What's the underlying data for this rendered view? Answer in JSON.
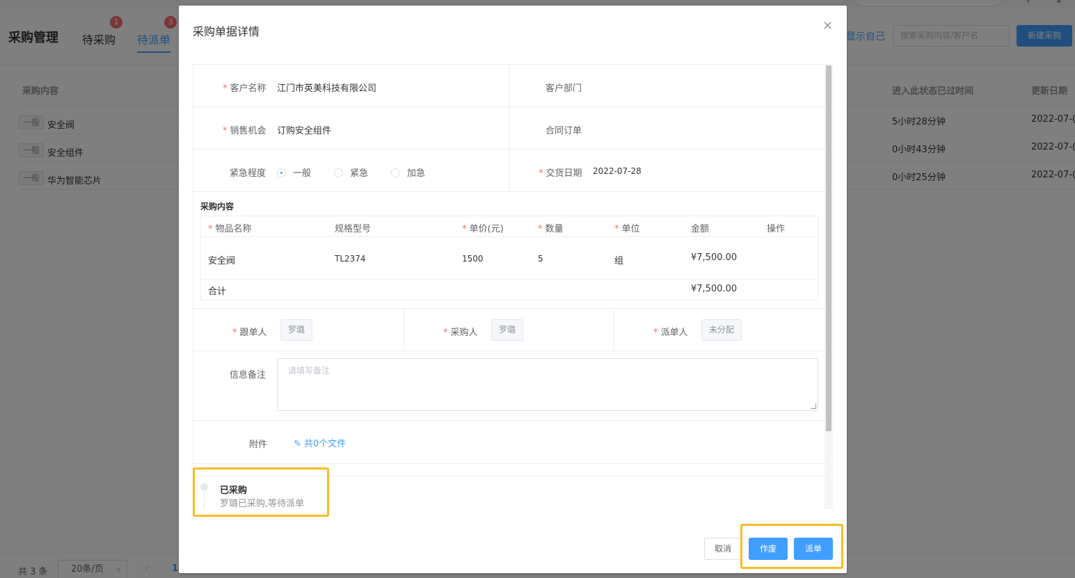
{
  "bg": {
    "title": "采购管理",
    "tabs": [
      {
        "label": "待采购",
        "badge": "1"
      },
      {
        "label": "待派单",
        "badge": "3"
      }
    ],
    "show_self": "显示自己",
    "search_placeholder": "搜索采购内容/客户名",
    "new_button": "新建采购",
    "columns": {
      "content": "采购内容",
      "elapsed": "进入此状态已过时间",
      "update": "更新日期"
    },
    "rows": [
      {
        "tag": "一般",
        "name": "安全阀",
        "elapsed": "5小时28分钟",
        "date": "2022-07-("
      },
      {
        "tag": "一般",
        "name": "安全组件",
        "elapsed": "0小时43分钟",
        "date": "2022-07-("
      },
      {
        "tag": "一般",
        "name": "华为智能芯片",
        "elapsed": "0小时25分钟",
        "date": "2022-07-("
      }
    ],
    "pagination": {
      "total": "共 3 条",
      "page_size": "20条/页",
      "current": "1"
    }
  },
  "dialog": {
    "title": "采购单据详情",
    "close": "×",
    "customer_label": "客户名称",
    "customer_value": "江门市英美科技有限公司",
    "dept_label": "客户部门",
    "opportunity_label": "销售机会",
    "opportunity_value": "订购安全组件",
    "contract_label": "合同订单",
    "urgency_label": "紧急程度",
    "urgency_options": [
      "一般",
      "紧急",
      "加急"
    ],
    "delivery_label": "交货日期",
    "delivery_value": "2022-07-28",
    "items_title": "采购内容",
    "items_headers": {
      "name": "物品名称",
      "spec": "规格型号",
      "price": "单价(元)",
      "qty": "数量",
      "unit": "单位",
      "amount": "金额",
      "op": "操作"
    },
    "items": [
      {
        "name": "安全阀",
        "spec": "TL2374",
        "price": "1500",
        "qty": "5",
        "unit": "组",
        "amount": "¥7,500.00"
      }
    ],
    "total_label": "合计",
    "total_value": "¥7,500.00",
    "follower_label": "跟单人",
    "follower_value": "罗璐",
    "buyer_label": "采购人",
    "buyer_value": "罗璐",
    "dispatcher_label": "派单人",
    "dispatcher_value": "未分配",
    "remark_label": "信息备注",
    "remark_placeholder": "请填写备注",
    "attach_label": "附件",
    "attach_link": "共0个文件",
    "timeline": {
      "title": "已采购",
      "desc": "罗璐已采购,等待派单"
    },
    "buttons": {
      "cancel": "取消",
      "void": "作废",
      "dispatch": "派单"
    }
  },
  "colors": {
    "primary": "#409eff",
    "required": "#f56c6c",
    "highlight": "#fbbd23"
  }
}
